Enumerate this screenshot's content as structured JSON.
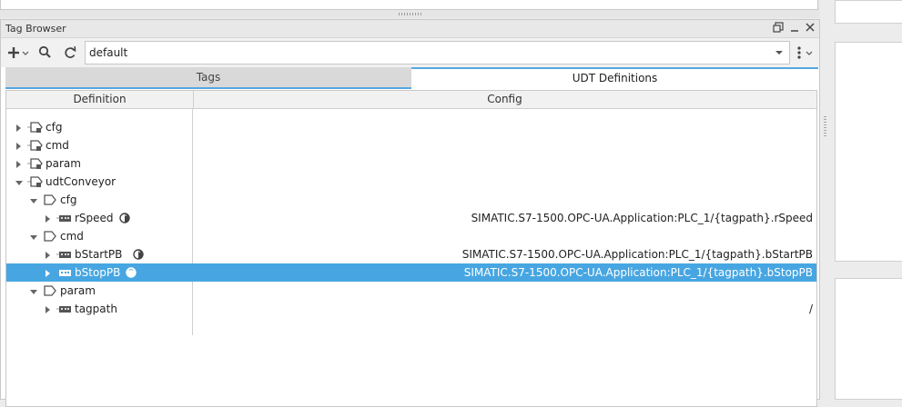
{
  "panel": {
    "title": "Tag Browser"
  },
  "toolbar": {
    "provider_value": "default",
    "add_icon": "plus-icon",
    "search_icon": "magnifier-icon",
    "refresh_icon": "refresh-icon",
    "menu_icon": "kebab-menu-icon"
  },
  "tabs": [
    {
      "label": "Tags",
      "active": false
    },
    {
      "label": "UDT Definitions",
      "active": true
    }
  ],
  "columns": {
    "definition": "Definition",
    "config": "Config"
  },
  "rows": [
    {
      "name": "cfg",
      "level": 0,
      "expanded": false,
      "type": "folder-udt",
      "config": ""
    },
    {
      "name": "cmd",
      "level": 0,
      "expanded": false,
      "type": "folder-udt",
      "config": ""
    },
    {
      "name": "param",
      "level": 0,
      "expanded": false,
      "type": "folder-udt",
      "config": ""
    },
    {
      "name": "udtConveyor",
      "level": 0,
      "expanded": true,
      "type": "folder-udt",
      "config": ""
    },
    {
      "name": "cfg",
      "level": 1,
      "expanded": true,
      "type": "folder",
      "config": ""
    },
    {
      "name": "rSpeed",
      "level": 2,
      "expanded": false,
      "type": "tag",
      "binding": true,
      "config": "SIMATIC.S7-1500.OPC-UA.Application:PLC_1/{tagpath}.rSpeed"
    },
    {
      "name": "cmd",
      "level": 1,
      "expanded": true,
      "type": "folder",
      "config": ""
    },
    {
      "name": "bStartPB",
      "level": 2,
      "expanded": false,
      "type": "tag",
      "binding": true,
      "config": "SIMATIC.S7-1500.OPC-UA.Application:PLC_1/{tagpath}.bStartPB"
    },
    {
      "name": "bStopPB",
      "level": 2,
      "expanded": false,
      "type": "tag",
      "binding": true,
      "selected": true,
      "config": "SIMATIC.S7-1500.OPC-UA.Application:PLC_1/{tagpath}.bStopPB"
    },
    {
      "name": "param",
      "level": 1,
      "expanded": true,
      "type": "folder",
      "config": ""
    },
    {
      "name": "tagpath",
      "level": 2,
      "expanded": false,
      "type": "tag",
      "binding": false,
      "config": "/"
    }
  ],
  "colors": {
    "selection": "#47a6e2",
    "tab_accent": "#55a7e0"
  }
}
